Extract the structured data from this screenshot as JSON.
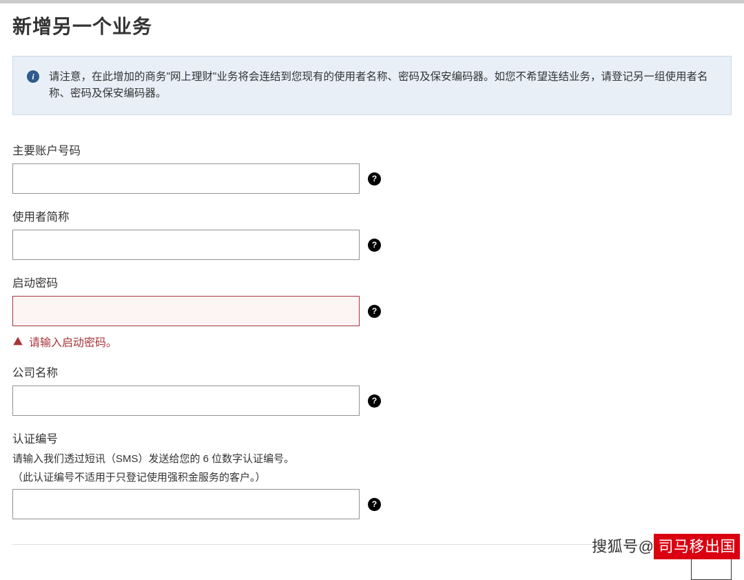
{
  "page": {
    "title": "新增另一个业务"
  },
  "notice": {
    "text": "请注意，在此增加的商务\"网上理财\"业务将会连结到您现有的使用者名称、密码及保安编码器。如您不希望连结业务，请登记另一组使用者名称、密码及保安编码器。"
  },
  "fields": {
    "account": {
      "label": "主要账户号码",
      "value": ""
    },
    "userAlias": {
      "label": "使用者简称",
      "value": ""
    },
    "activationPassword": {
      "label": "启动密码",
      "value": "",
      "error": "请输入启动密码。"
    },
    "companyName": {
      "label": "公司名称",
      "value": ""
    },
    "authCode": {
      "label": "认证编号",
      "help1": "请输入我们透过短讯（SMS）发送给您的 6 位数字认证编号。",
      "help2": "（此认证编号不适用于只登记使用强积金服务的客户。）",
      "value": ""
    }
  },
  "watermark": {
    "prefix": "搜狐号@",
    "suffix": "司马移出国"
  }
}
